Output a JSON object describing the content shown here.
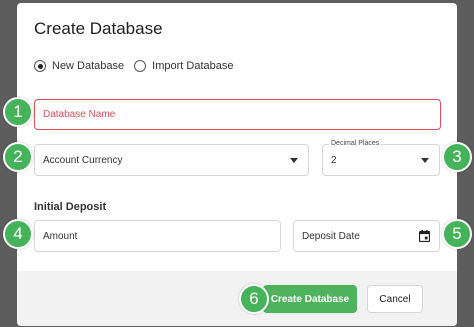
{
  "dialog": {
    "title": "Create Database",
    "radios": [
      {
        "label": "New Database",
        "checked": true
      },
      {
        "label": "Import Database",
        "checked": false
      }
    ],
    "fields": {
      "database_name": {
        "placeholder": "Database Name",
        "state": "error"
      },
      "account_currency": {
        "value": "Account Currency"
      },
      "decimal_places": {
        "label": "Decimal Places",
        "value": "2"
      },
      "amount": {
        "placeholder": "Amount"
      },
      "deposit_date": {
        "placeholder": "Deposit Date"
      }
    },
    "section_label": "Initial Deposit",
    "buttons": {
      "create": "Create Database",
      "cancel": "Cancel"
    }
  },
  "badges": [
    "1",
    "2",
    "3",
    "4",
    "5",
    "6"
  ],
  "colors": {
    "backdrop": "#5d5d5d",
    "badge": "#44b35a",
    "primary": "#4fb35e",
    "error": "#e0505a"
  },
  "icons": {
    "select_arrow": "caret-down-icon",
    "calendar": "calendar-icon"
  }
}
